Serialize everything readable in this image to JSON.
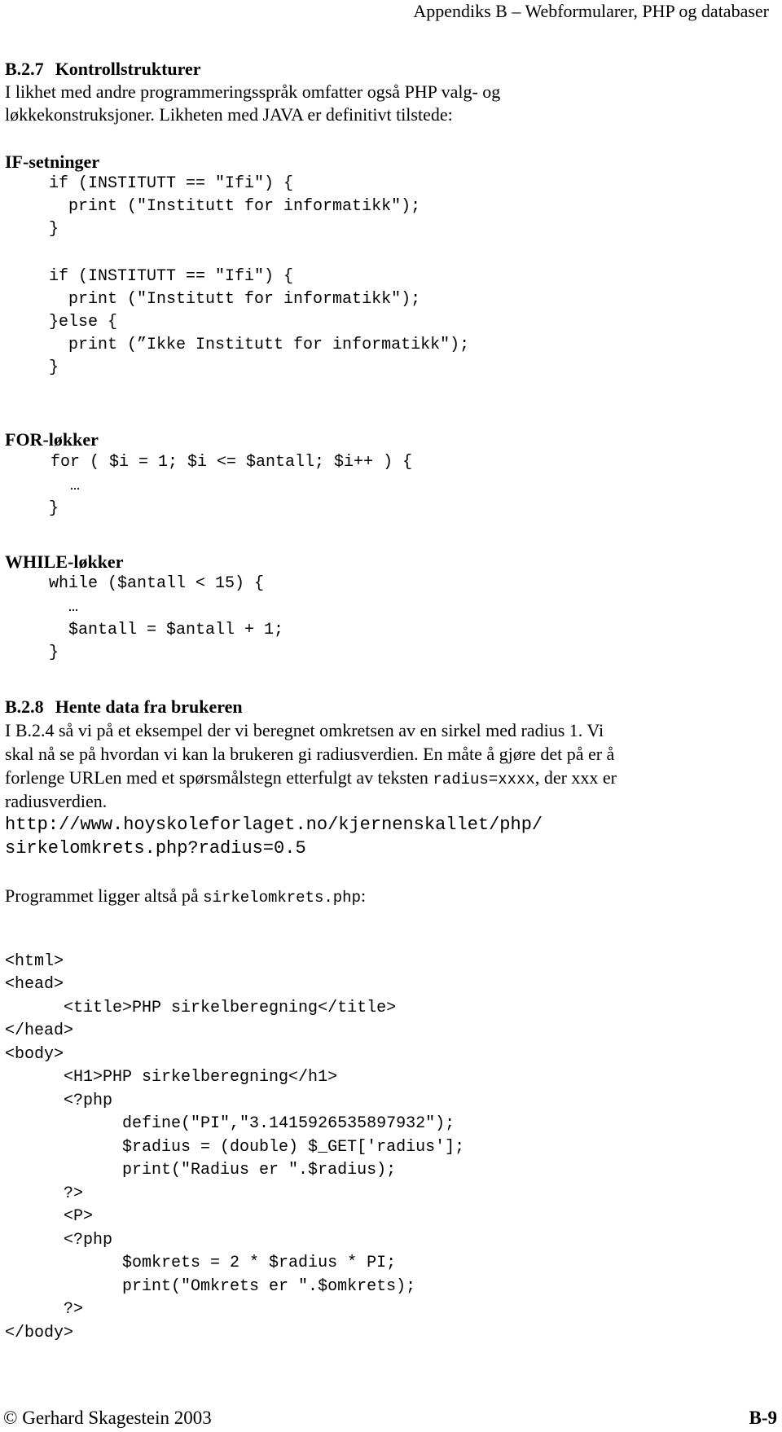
{
  "header": {
    "running_title": "Appendiks B – Webformularer, PHP og databaser"
  },
  "section_b27": {
    "number": "B.2.7",
    "title": "Kontrollstrukturer",
    "intro_lines": [
      "I likhet med andre programmeringsspråk omfatter også PHP valg- og",
      "løkkekonstruksjoner. Likheten med JAVA er definitivt tilstede:"
    ],
    "if_heading": "IF-setninger",
    "if_code": [
      "if (INSTITUTT == \"Ifi\") {",
      "  print (\"Institutt for informatikk\");",
      "}",
      "",
      "if (INSTITUTT == \"Ifi\") {",
      "  print (\"Institutt for informatikk\");",
      "}else {",
      "  print (”Ikke Institutt for informatikk\");",
      "}"
    ],
    "for_heading": "FOR-løkker",
    "for_code": [
      "for ( $i = 1; $i <= $antall; $i++ ) {",
      "  …",
      "}"
    ],
    "while_heading": "WHILE-løkker",
    "while_code": [
      "while ($antall < 15) {",
      "  …",
      "  $antall = $antall + 1;",
      "}"
    ]
  },
  "section_b28": {
    "number": "B.2.8",
    "title": "Hente data fra brukeren",
    "para_lines": [
      "I B.2.4 så vi på et eksempel der vi beregnet omkretsen av en sirkel med radius 1. Vi",
      "skal nå se på hvordan vi kan la brukeren gi radiusverdien. En måte å gjøre det på er å"
    ],
    "para_line3_before": "forlenge URLen med et spørsmålstegn etterfulgt av teksten ",
    "para_line3_code": "radius=xxxx",
    "para_line3_after": ", der xxx er",
    "para_line4": "radiusverdien.",
    "url_lines": [
      "http://www.hoyskoleforlaget.no/kjernenskallet/php/",
      "sirkelomkrets.php?radius=0.5"
    ],
    "program_text_before": "Programmet ligger altså på ",
    "program_text_code": "sirkelomkrets.php",
    "program_text_after": ":",
    "program_code": [
      "<html>",
      "<head>",
      "      <title>PHP sirkelberegning</title>",
      "</head>",
      "<body>",
      "      <H1>PHP sirkelberegning</h1>",
      "      <?php",
      "            define(\"PI\",\"3.1415926535897932\");",
      "            $radius = (double) $_GET['radius'];",
      "            print(\"Radius er \".$radius);",
      "      ?>",
      "      <P>",
      "      <?php",
      "            $omkrets = 2 * $radius * PI;",
      "            print(\"Omkrets er \".$omkrets);",
      "      ?>",
      "</body>"
    ]
  },
  "footer": {
    "copyright": "© Gerhard Skagestein 2003",
    "page_number": "B-9"
  }
}
